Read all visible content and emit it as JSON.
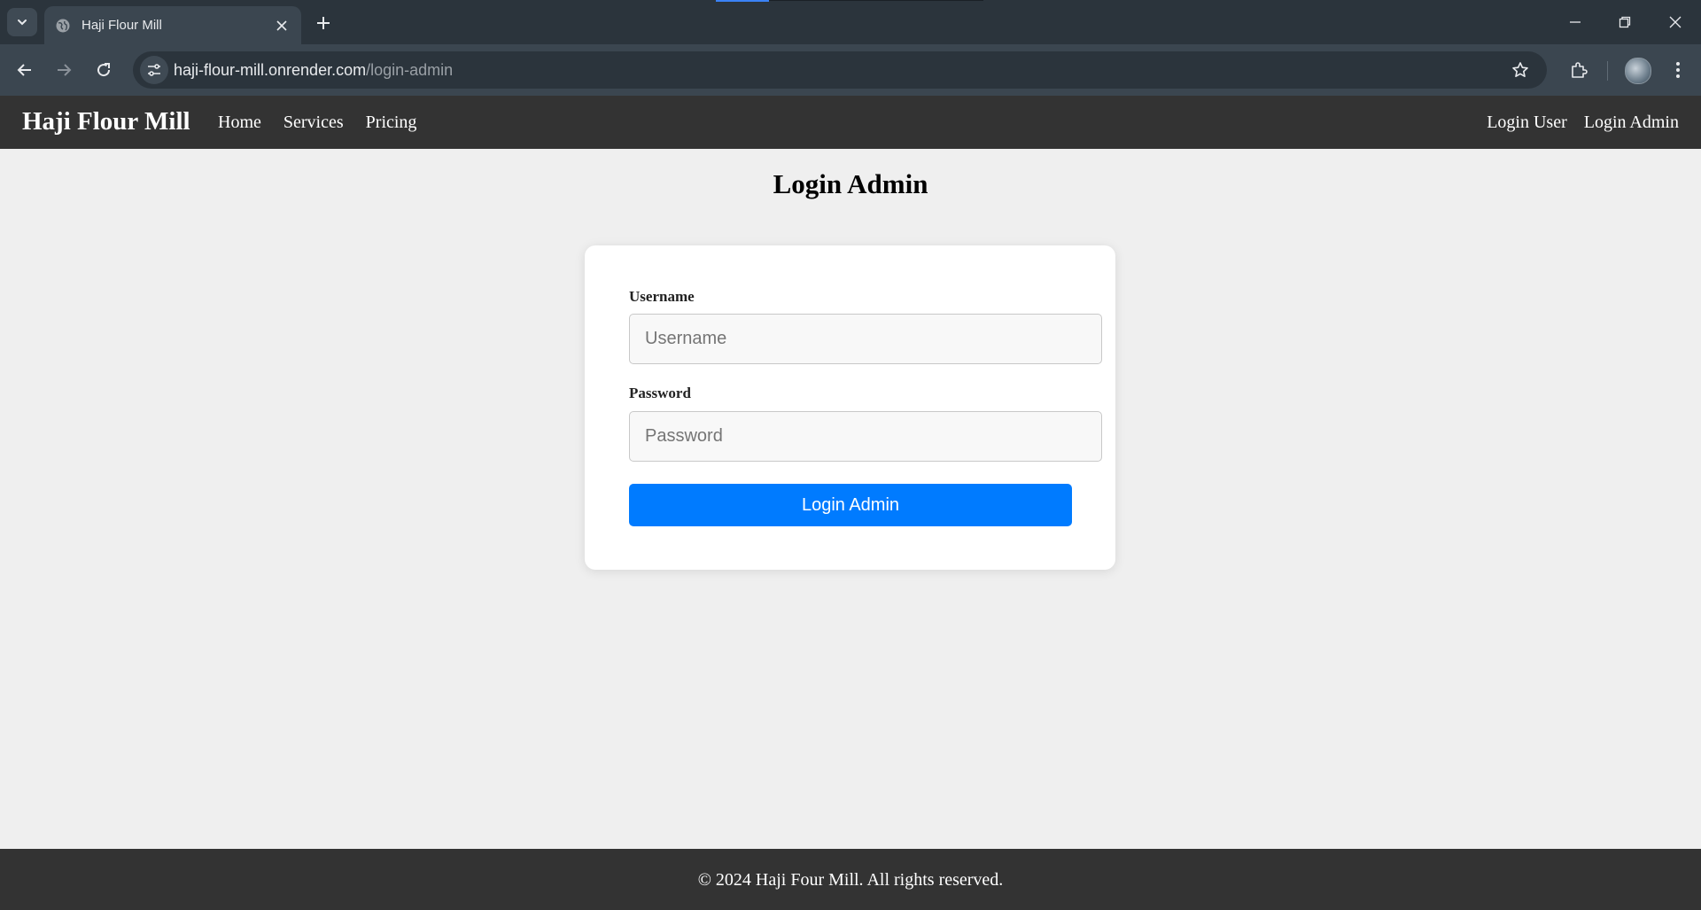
{
  "browser": {
    "tab_title": "Haji Flour Mill",
    "url_host": "haji-flour-mill.onrender.com",
    "url_path": "/login-admin",
    "icons": [
      "tab-search-icon",
      "globe-icon",
      "close-icon",
      "plus-icon",
      "minimize-icon",
      "restore-icon",
      "window-close-icon",
      "back-arrow-icon",
      "forward-arrow-icon",
      "reload-icon",
      "site-info-icon",
      "star-icon",
      "extensions-icon",
      "profile-avatar",
      "kebab-menu-icon"
    ]
  },
  "navbar": {
    "brand": "Haji Flour Mill",
    "links": [
      "Home",
      "Services",
      "Pricing"
    ],
    "right_links": [
      "Login User",
      "Login Admin"
    ]
  },
  "main": {
    "title": "Login Admin",
    "form": {
      "username_label": "Username",
      "username_placeholder": "Username",
      "username_value": "",
      "password_label": "Password",
      "password_placeholder": "Password",
      "password_value": "",
      "submit_label": "Login Admin"
    }
  },
  "footer": {
    "text": "© 2024 Haji Four Mill. All rights reserved."
  },
  "colors": {
    "chrome_dark": "#2b343c",
    "chrome_toolbar": "#3b4650",
    "navbar_bg": "#333333",
    "page_bg": "#efefef",
    "button_blue": "#007bff"
  }
}
